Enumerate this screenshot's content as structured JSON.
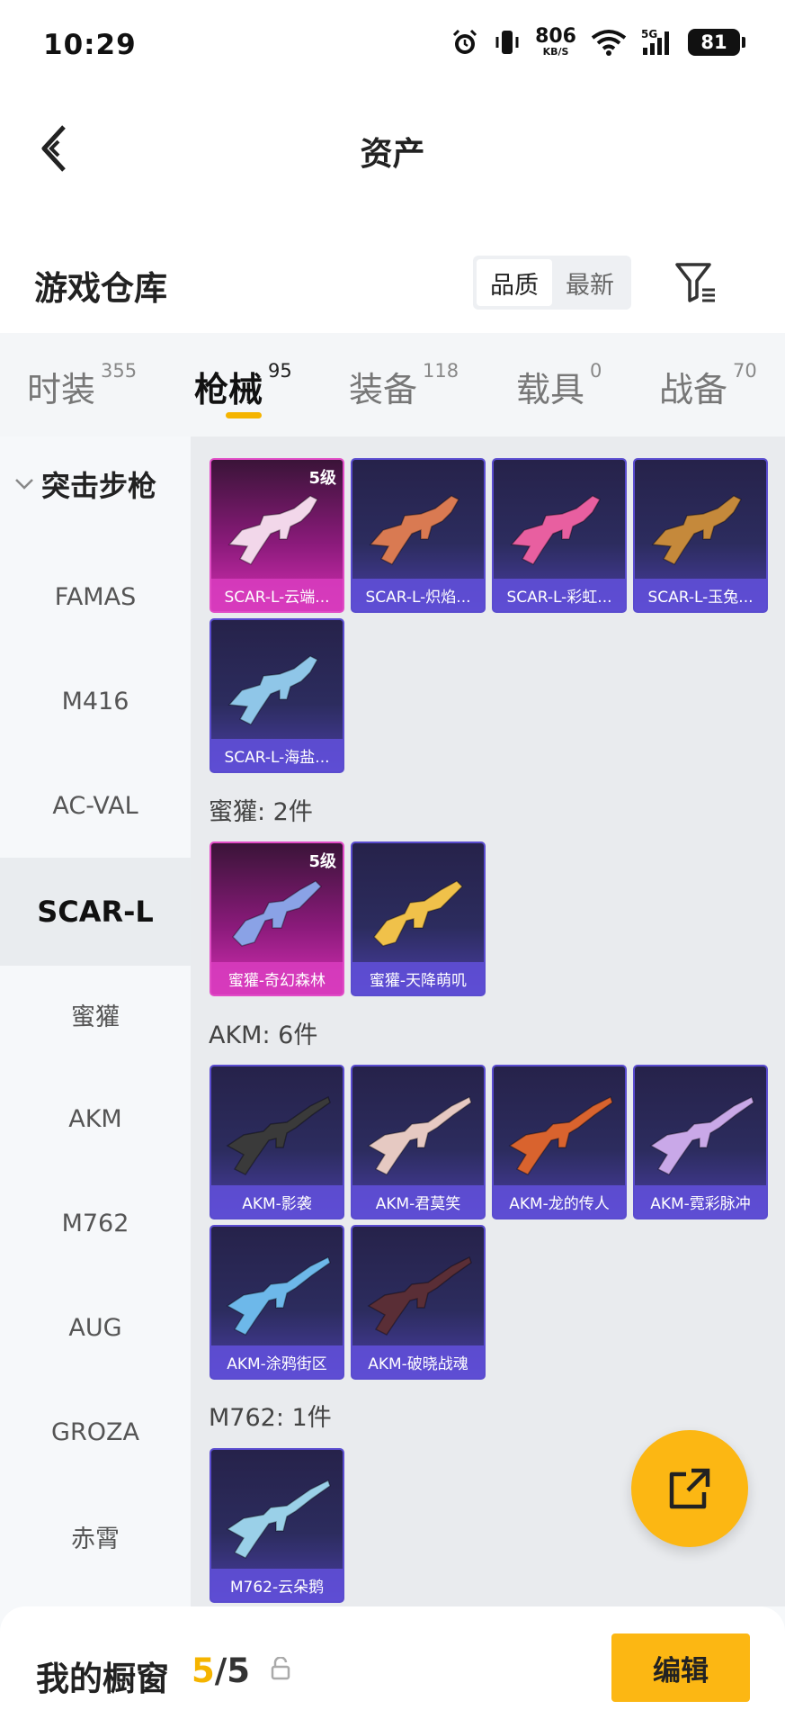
{
  "status_bar": {
    "time": "10:29",
    "net_speed": "806",
    "net_unit": "KB/S",
    "signal_label": "5G",
    "battery": "81"
  },
  "nav": {
    "title": "资产"
  },
  "warehouse": {
    "title": "游戏仓库",
    "sort_options": [
      "品质",
      "最新"
    ],
    "active_sort": "品质"
  },
  "tabs": [
    {
      "label": "时装",
      "count": "355"
    },
    {
      "label": "枪械",
      "count": "95"
    },
    {
      "label": "装备",
      "count": "118"
    },
    {
      "label": "载具",
      "count": "0"
    },
    {
      "label": "战备",
      "count": "70"
    }
  ],
  "active_tab": "枪械",
  "sidebar": {
    "group": "突击步枪",
    "items": [
      "FAMAS",
      "M416",
      "AC-VAL",
      "SCAR-L",
      "蜜獾",
      "AKM",
      "M762",
      "AUG",
      "GROZA",
      "赤霄"
    ],
    "active": "SCAR-L"
  },
  "sections": [
    {
      "label": "",
      "items": [
        {
          "name": "SCAR-L-云端...",
          "level": "5级",
          "rarity": "legendary",
          "color": "#f2d7ea",
          "type": "scar"
        },
        {
          "name": "SCAR-L-炽焰...",
          "level": "",
          "rarity": "epic",
          "color": "#d97a52",
          "type": "scar"
        },
        {
          "name": "SCAR-L-彩虹...",
          "level": "",
          "rarity": "epic",
          "color": "#e85fa0",
          "type": "scar"
        },
        {
          "name": "SCAR-L-玉兔...",
          "level": "",
          "rarity": "epic",
          "color": "#c5893b",
          "type": "scar"
        },
        {
          "name": "SCAR-L-海盐...",
          "level": "",
          "rarity": "epic",
          "color": "#8fc6e8",
          "type": "scar"
        }
      ]
    },
    {
      "label": "蜜獾: 2件",
      "items": [
        {
          "name": "蜜獾-奇幻森林",
          "level": "5级",
          "rarity": "legendary",
          "color": "#8aa2e6",
          "type": "smg"
        },
        {
          "name": "蜜獾-天降萌叽",
          "level": "",
          "rarity": "epic",
          "color": "#f0c14a",
          "type": "smg"
        }
      ]
    },
    {
      "label": "AKM: 6件",
      "items": [
        {
          "name": "AKM-影袭",
          "level": "",
          "rarity": "epic",
          "color": "#3a3a3a",
          "type": "akm"
        },
        {
          "name": "AKM-君莫笑",
          "level": "",
          "rarity": "epic",
          "color": "#e6c9c2",
          "type": "akm"
        },
        {
          "name": "AKM-龙的传人",
          "level": "",
          "rarity": "epic",
          "color": "#d9632e",
          "type": "akm"
        },
        {
          "name": "AKM-霓彩脉冲",
          "level": "",
          "rarity": "epic",
          "color": "#c9a8e8",
          "type": "akm"
        },
        {
          "name": "AKM-涂鸦街区",
          "level": "",
          "rarity": "epic",
          "color": "#6db8ea",
          "type": "akm"
        },
        {
          "name": "AKM-破晓战魂",
          "level": "",
          "rarity": "epic",
          "color": "#5a2e36",
          "type": "akm"
        }
      ]
    },
    {
      "label": "M762: 1件",
      "items": [
        {
          "name": "M762-云朵鹅",
          "level": "",
          "rarity": "epic",
          "color": "#9ad0e8",
          "type": "akm"
        }
      ]
    }
  ],
  "showcase": {
    "title": "我的橱窗",
    "current": "5",
    "total": "/5"
  },
  "edit_button": "编辑",
  "colors": {
    "accent": "#fcb713",
    "legendary": "#d62fb3",
    "epic": "#5a4ccf"
  }
}
